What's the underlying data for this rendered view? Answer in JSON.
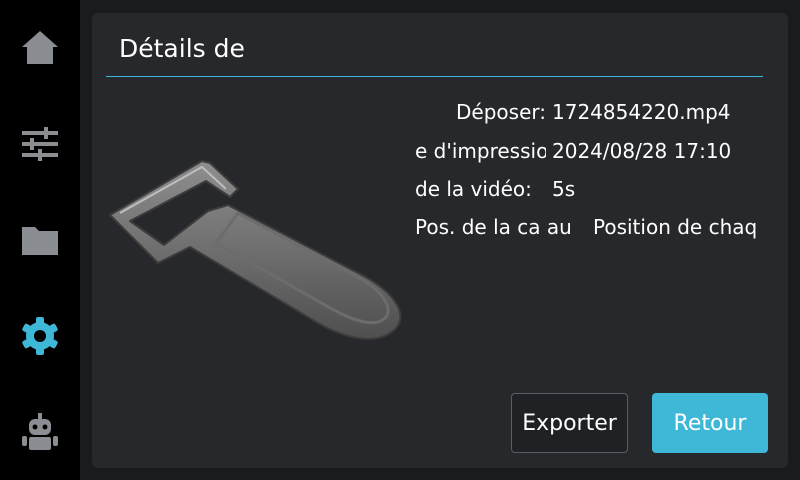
{
  "sidebar": {
    "items": [
      {
        "icon": "home-icon",
        "active": false
      },
      {
        "icon": "sliders-icon",
        "active": false
      },
      {
        "icon": "folder-icon",
        "active": false
      },
      {
        "icon": "gear-icon",
        "active": true
      },
      {
        "icon": "robot-icon",
        "active": false
      }
    ],
    "active_color": "#3fb7d7",
    "inactive_color": "#8a8d91"
  },
  "dialog": {
    "title": "Détails de",
    "preview_icon": "bottle-opener-model",
    "fields": [
      {
        "label": "Déposer:",
        "value": "1724854220.mp4"
      },
      {
        "label": "e d'impressio",
        "value": "2024/08/28 17:10"
      },
      {
        "label": "de la vidéo:",
        "value": "5s"
      },
      {
        "label": "Pos. de la ca au",
        "value": "Position de chaq"
      }
    ],
    "buttons": {
      "export": "Exporter",
      "back": "Retour"
    }
  },
  "colors": {
    "accent": "#3fb7d7",
    "panel": "#26282b",
    "sidebar": "#000000"
  }
}
